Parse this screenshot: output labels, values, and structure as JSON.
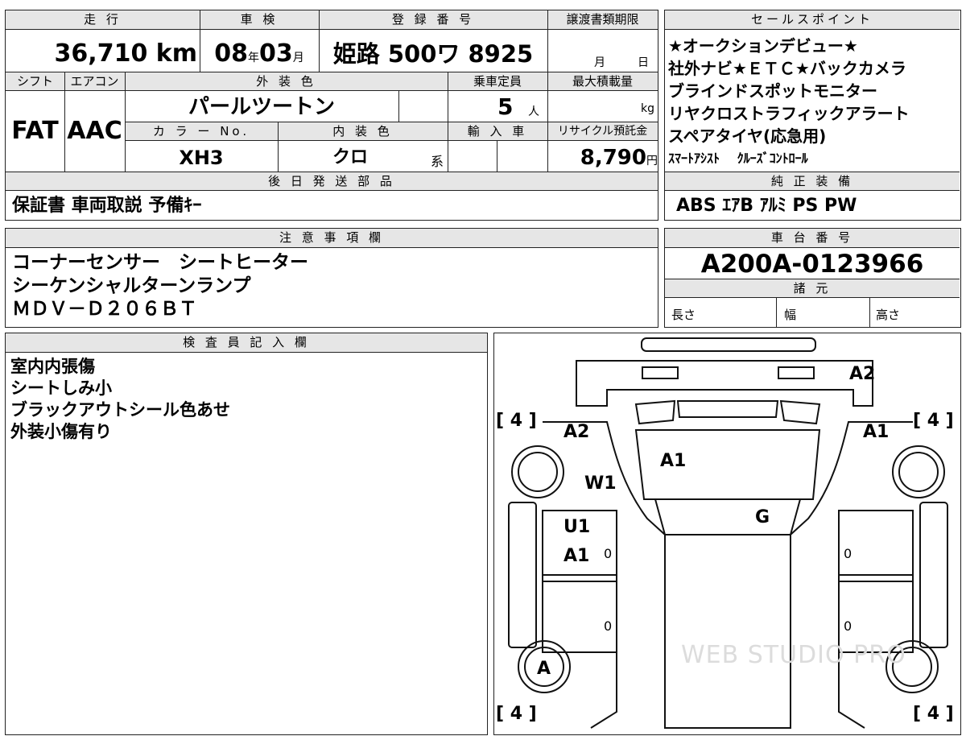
{
  "header": {
    "mileage_label": "走 行",
    "inspection_label": "車 検",
    "registration_label": "登 録 番 号",
    "transfer_deadline_label": "譲渡書類期限",
    "shift_label": "シフト",
    "aircon_label": "エアコン",
    "exterior_color_label": "外 装 色",
    "capacity_label": "乗車定員",
    "max_load_label": "最大積載量",
    "color_no_label": "カ ラ ー No.",
    "interior_color_label": "内 装 色",
    "import_label": "輸 入 車",
    "recycle_label": "リサイクル預託金"
  },
  "vehicle": {
    "mileage": "36,710",
    "mileage_unit": "km",
    "inspection_year": "08",
    "year_unit": "年",
    "inspection_month": "03",
    "month_unit": "月",
    "registration": "姫路 500ワ 8925",
    "deadline_month_unit": "月",
    "deadline_day_unit": "日",
    "shift": "FAT",
    "aircon": "AAC",
    "exterior_color": "パールツートン",
    "capacity": "5",
    "capacity_unit": "人",
    "max_load_unit": "kg",
    "color_no": "XH3",
    "interior_color": "クロ",
    "interior_suffix": "系",
    "recycle_fee": "8,790",
    "recycle_unit": "円"
  },
  "sales_points": {
    "label": "セールスポイント",
    "lines": [
      "★オークションデビュー★",
      "社外ナビ★ＥＴＣ★バックカメラ",
      "ブラインドスポットモニター",
      "リヤクロストラフィックアラート",
      "スペアタイヤ(応急用)",
      "ｽﾏｰﾄｱｼｽﾄ　 ｸﾙｰｽﾞｺﾝﾄﾛｰﾙ"
    ]
  },
  "shipping_parts": {
    "label": "後 日 発 送 部 品",
    "value": "保証書 車両取説 予備ｷｰ"
  },
  "standard_equipment": {
    "label": "純 正 装 備",
    "value": "ABS ｴｱB ｱﾙﾐ PS PW"
  },
  "notes": {
    "label": "注 意 事 項 欄",
    "lines": [
      "コーナーセンサー　シートヒーター",
      "シーケンシャルターンランプ",
      "ＭＤＶ－Ｄ２０６ＢＴ"
    ]
  },
  "chassis": {
    "label": "車 台 番 号",
    "value": "A200A-0123966"
  },
  "specs": {
    "label": "諸 元",
    "length_label": "長さ",
    "width_label": "幅",
    "height_label": "高さ"
  },
  "inspector": {
    "label": "検 査 員 記 入 欄",
    "lines": [
      "室内内張傷",
      "シートしみ小",
      "ブラックアウトシール色あせ",
      "外装小傷有り"
    ]
  },
  "diagram": {
    "tire_marks": [
      "[ 4 ]",
      "[ 4 ]",
      "[ 4 ]",
      "[ 4 ]"
    ],
    "damage_codes": {
      "rear_right_top": "A2",
      "rear_left": "A2",
      "rear_right": "A1",
      "roof": "A1",
      "left_side": "W1",
      "rear_glass": "G",
      "left_door_1": "U1",
      "left_door_2": "A1",
      "front_left_wheel": "A"
    },
    "zero_marks": [
      "0",
      "0",
      "0",
      "0"
    ],
    "watermark": "WEB STUDIO PRO"
  }
}
